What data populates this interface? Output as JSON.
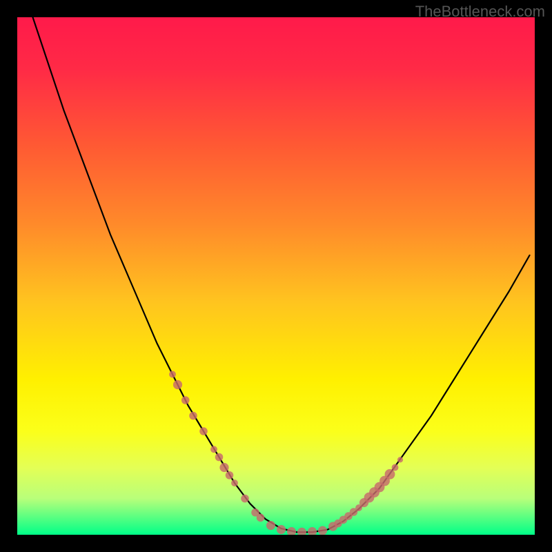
{
  "watermark": "TheBottleneck.com",
  "colors": {
    "gradient_stops": [
      {
        "offset": 0.0,
        "color": "#ff1a4a"
      },
      {
        "offset": 0.1,
        "color": "#ff2a46"
      },
      {
        "offset": 0.25,
        "color": "#ff5a33"
      },
      {
        "offset": 0.4,
        "color": "#ff8a2a"
      },
      {
        "offset": 0.55,
        "color": "#ffc41f"
      },
      {
        "offset": 0.7,
        "color": "#fff000"
      },
      {
        "offset": 0.8,
        "color": "#fbff1a"
      },
      {
        "offset": 0.87,
        "color": "#e4ff55"
      },
      {
        "offset": 0.93,
        "color": "#b8ff7a"
      },
      {
        "offset": 1.0,
        "color": "#00ff88"
      }
    ],
    "curve": "#000000",
    "markers": "#c76a6b",
    "frame": "#000000"
  },
  "chart_data": {
    "type": "line",
    "title": "",
    "xlabel": "",
    "ylabel": "",
    "xlim": [
      0,
      100
    ],
    "ylim": [
      0,
      100
    ],
    "series": [
      {
        "name": "bottleneck-curve",
        "x": [
          3,
          6,
          9,
          12,
          15,
          18,
          21,
          24,
          27,
          30,
          33,
          36,
          39,
          40.5,
          42,
          45,
          48,
          51,
          54,
          57,
          60,
          63,
          66,
          70,
          75,
          80,
          85,
          90,
          95,
          99
        ],
        "y": [
          100,
          91,
          82,
          74,
          66,
          58,
          51,
          44,
          37,
          31,
          25,
          20,
          15,
          12.5,
          10,
          6,
          3,
          1.2,
          0.5,
          0.5,
          1,
          2.6,
          5,
          9,
          16,
          23,
          31,
          39,
          47,
          54
        ]
      }
    ],
    "markers": [
      {
        "x": 30,
        "y": 31,
        "r": 1.2
      },
      {
        "x": 31,
        "y": 29,
        "r": 1.6
      },
      {
        "x": 32.5,
        "y": 26,
        "r": 1.4
      },
      {
        "x": 34,
        "y": 23,
        "r": 1.4
      },
      {
        "x": 36,
        "y": 20,
        "r": 1.4
      },
      {
        "x": 38,
        "y": 16.5,
        "r": 1.2
      },
      {
        "x": 39,
        "y": 15,
        "r": 1.4
      },
      {
        "x": 40,
        "y": 13,
        "r": 1.6
      },
      {
        "x": 41,
        "y": 11.5,
        "r": 1.4
      },
      {
        "x": 42,
        "y": 10,
        "r": 1.2
      },
      {
        "x": 44,
        "y": 7,
        "r": 1.4
      },
      {
        "x": 46,
        "y": 4.3,
        "r": 1.4
      },
      {
        "x": 47,
        "y": 3.3,
        "r": 1.4
      },
      {
        "x": 49,
        "y": 1.8,
        "r": 1.6
      },
      {
        "x": 51,
        "y": 1.0,
        "r": 1.6
      },
      {
        "x": 53,
        "y": 0.6,
        "r": 1.6
      },
      {
        "x": 55,
        "y": 0.5,
        "r": 1.6
      },
      {
        "x": 57,
        "y": 0.6,
        "r": 1.6
      },
      {
        "x": 59,
        "y": 0.8,
        "r": 1.6
      },
      {
        "x": 61,
        "y": 1.6,
        "r": 1.6
      },
      {
        "x": 62,
        "y": 2.2,
        "r": 1.4
      },
      {
        "x": 63,
        "y": 2.9,
        "r": 1.4
      },
      {
        "x": 64,
        "y": 3.6,
        "r": 1.4
      },
      {
        "x": 65,
        "y": 4.4,
        "r": 1.4
      },
      {
        "x": 66,
        "y": 5.2,
        "r": 1.2
      },
      {
        "x": 67,
        "y": 6.2,
        "r": 1.6
      },
      {
        "x": 68,
        "y": 7.2,
        "r": 1.8
      },
      {
        "x": 69,
        "y": 8.2,
        "r": 1.8
      },
      {
        "x": 70,
        "y": 9.2,
        "r": 1.8
      },
      {
        "x": 71,
        "y": 10.4,
        "r": 1.8
      },
      {
        "x": 72,
        "y": 11.7,
        "r": 1.8
      },
      {
        "x": 73,
        "y": 13.0,
        "r": 1.2
      },
      {
        "x": 74,
        "y": 14.5,
        "r": 1.0
      }
    ]
  }
}
